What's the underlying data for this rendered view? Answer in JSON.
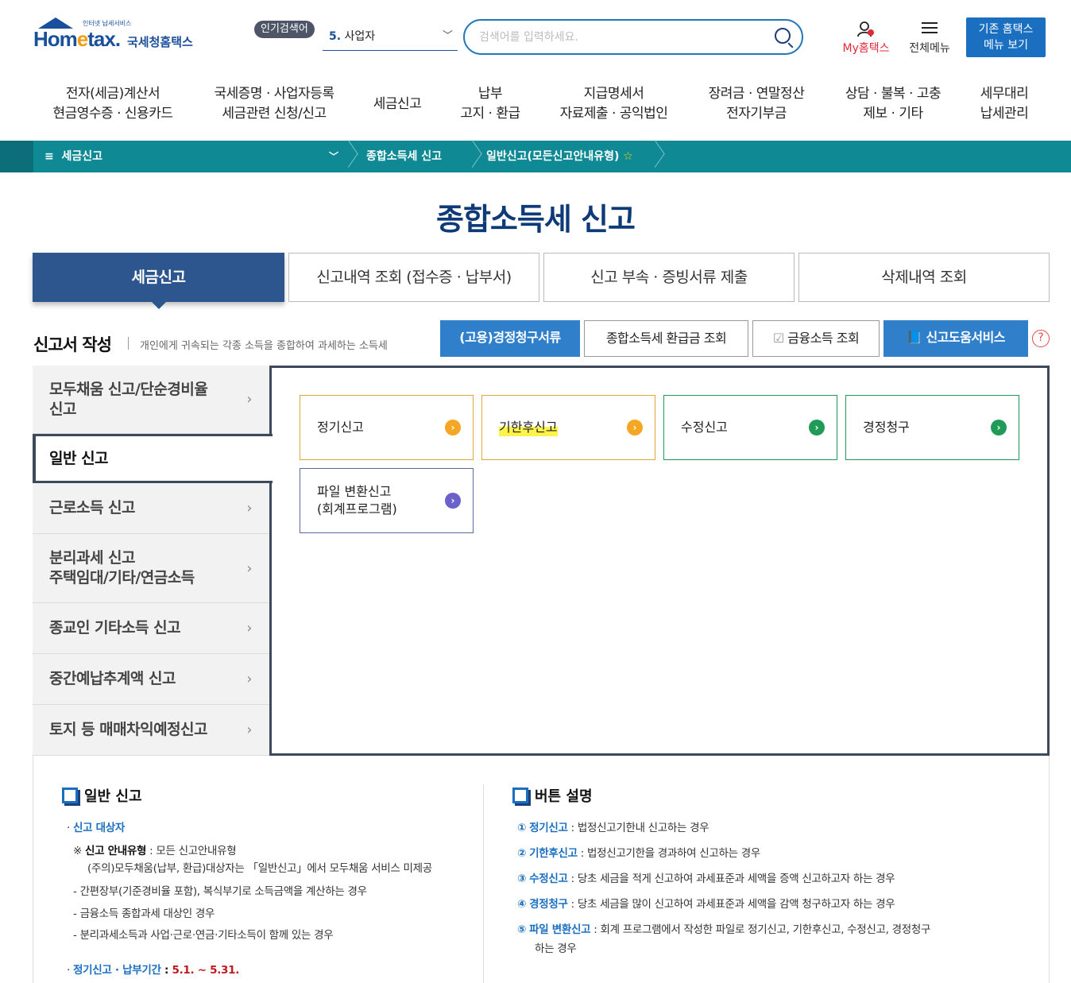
{
  "header": {
    "logo_tag": "인터넷 납세서비스",
    "logo_home": "Hom",
    "logo_e": "e",
    "logo_tax": "tax.",
    "logo_kr": "국세청홈택스",
    "popular_badge": "인기검색어",
    "popular_num": "5.",
    "popular_term": "사업자",
    "search_placeholder": "검색어를 입력하세요.",
    "my_hometax": "My홈택스",
    "all_menu": "전체메뉴",
    "old_menu_line1": "기존 홈택스",
    "old_menu_line2": "메뉴 보기"
  },
  "gnb": [
    {
      "l1": "전자(세금)계산서",
      "l2": "현금영수증 · 신용카드"
    },
    {
      "l1": "국세증명 · 사업자등록",
      "l2": "세금관련 신청/신고"
    },
    {
      "l1": "세금신고",
      "l2": ""
    },
    {
      "l1": "납부",
      "l2": "고지 · 환급"
    },
    {
      "l1": "지급명세서",
      "l2": "자료제출 · 공익법인"
    },
    {
      "l1": "장려금 · 연말정산",
      "l2": "전자기부금"
    },
    {
      "l1": "상담 · 불복 · 고충",
      "l2": "제보 · 기타"
    },
    {
      "l1": "세무대리",
      "l2": "납세관리"
    }
  ],
  "breadcrumb": {
    "menu": "세금신고",
    "item1": "종합소득세 신고",
    "item2": "일반신고(모든신고안내유형)"
  },
  "page_title": "종합소득세 신고",
  "tabs": [
    "세금신고",
    "신고내역 조회 (접수증 · 납부서)",
    "신고 부속 · 증빙서류 제출",
    "삭제내역 조회"
  ],
  "section": {
    "title": "신고서 작성",
    "desc": "개인에게 귀속되는 각종 소득을 종합하여 과세하는 소득세",
    "btn1": "(고용)경정청구서류",
    "btn2": "종합소득세 환급금 조회",
    "btn3": "금융소득 조회",
    "btn4": "신고도움서비스",
    "help": "?"
  },
  "leftnav": [
    {
      "l1": "모두채움 신고/단순경비율",
      "l2": "신고"
    },
    {
      "l1": "일반 신고",
      "l2": ""
    },
    {
      "l1": "근로소득 신고",
      "l2": ""
    },
    {
      "l1": "분리과세 신고",
      "l2": "주택임대/기타/연금소득"
    },
    {
      "l1": "종교인 기타소득 신고",
      "l2": ""
    },
    {
      "l1": "중간예납추계액 신고",
      "l2": ""
    },
    {
      "l1": "토지 등 매매차익예정신고",
      "l2": ""
    }
  ],
  "options": [
    {
      "l1": "정기신고",
      "l2": ""
    },
    {
      "l1": "기한후신고",
      "l2": ""
    },
    {
      "l1": "수정신고",
      "l2": ""
    },
    {
      "l1": "경정청구",
      "l2": ""
    },
    {
      "l1": "파일 변환신고",
      "l2": "(회계프로그램)"
    }
  ],
  "info_left": {
    "title": "일반 신고",
    "target_label": "신고 대상자",
    "note_label": "신고 안내유형",
    "note_text": " : 모든 신고안내유형",
    "note_caution": "(주의)모두채움(납부, 환급)대상자는 「일반신고」에서 모두채움 서비스 미제공",
    "items": [
      "- 간편장부(기준경비율 포함), 복식부기로 소득금액을 계산하는 경우",
      "- 금융소득 종합과세 대상인 경우",
      "- 분리과세소득과 사업·근로·연금·기타소득이 함께 있는 경우"
    ],
    "period_label": "정기신고 · 납부기간",
    "period_value": "5.1. ~ 5.31."
  },
  "info_right": {
    "title": "버튼 설명",
    "items": [
      {
        "num": "①",
        "label": "정기신고",
        "text": " : 법정신고기한내 신고하는 경우"
      },
      {
        "num": "②",
        "label": "기한후신고",
        "text": " : 법정신고기한을 경과하여 신고하는 경우"
      },
      {
        "num": "③",
        "label": "수정신고",
        "text": " : 당초 세금을 적게 신고하여 과세표준과 세액을 증액 신고하고자 하는 경우"
      },
      {
        "num": "④",
        "label": "경정청구",
        "text": " : 당초 세금을 많이 신고하여 과세표준과 세액을 감액 청구하고자 하는 경우"
      },
      {
        "num": "⑤",
        "label": "파일 변환신고",
        "text": " : 회계 프로그램에서 작성한 파일로 정기신고, 기한후신고, 수정신고, 경정청구"
      }
    ],
    "item5_cont": "하는 경우"
  }
}
